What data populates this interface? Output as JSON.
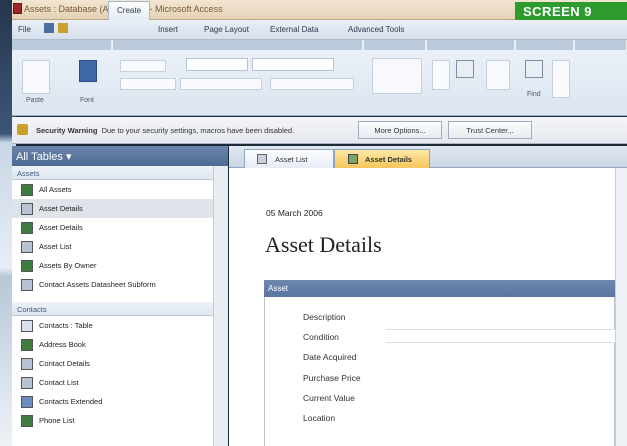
{
  "window": {
    "title": "Assets : Database (Access 12) - Microsoft Access"
  },
  "badge": "SCREEN 9",
  "ribbon_tabs": [
    "File",
    "Create",
    "Insert",
    "Page Layout",
    "External Data",
    "Advanced Tools"
  ],
  "ribbon": {
    "paste_label": "Paste",
    "font_label": "Font",
    "find_label": "Find"
  },
  "security": {
    "title": "Security Warning",
    "message": "Due to your security settings, macros have been disabled.",
    "more_options": "More Options...",
    "trust_center": "Trust Center..."
  },
  "nav": {
    "header": "All Tables",
    "sections": [
      {
        "name": "Assets",
        "items": [
          "All Assets",
          "Asset Details",
          "Asset Details",
          "Asset List",
          "Assets By Owner",
          "Contact Assets Datasheet Subform"
        ]
      },
      {
        "name": "Contacts",
        "items": [
          "Contacts : Table",
          "Address Book",
          "Contact Details",
          "Contact List",
          "Contacts Extended",
          "Phone List"
        ]
      }
    ]
  },
  "doc": {
    "tabs": [
      "Asset List",
      "Asset Details"
    ],
    "date": "05 March 2006",
    "title": "Asset Details",
    "section_header": "Asset",
    "fields": [
      "Description",
      "Condition",
      "Date Acquired",
      "Purchase Price",
      "Current Value",
      "Location"
    ]
  }
}
